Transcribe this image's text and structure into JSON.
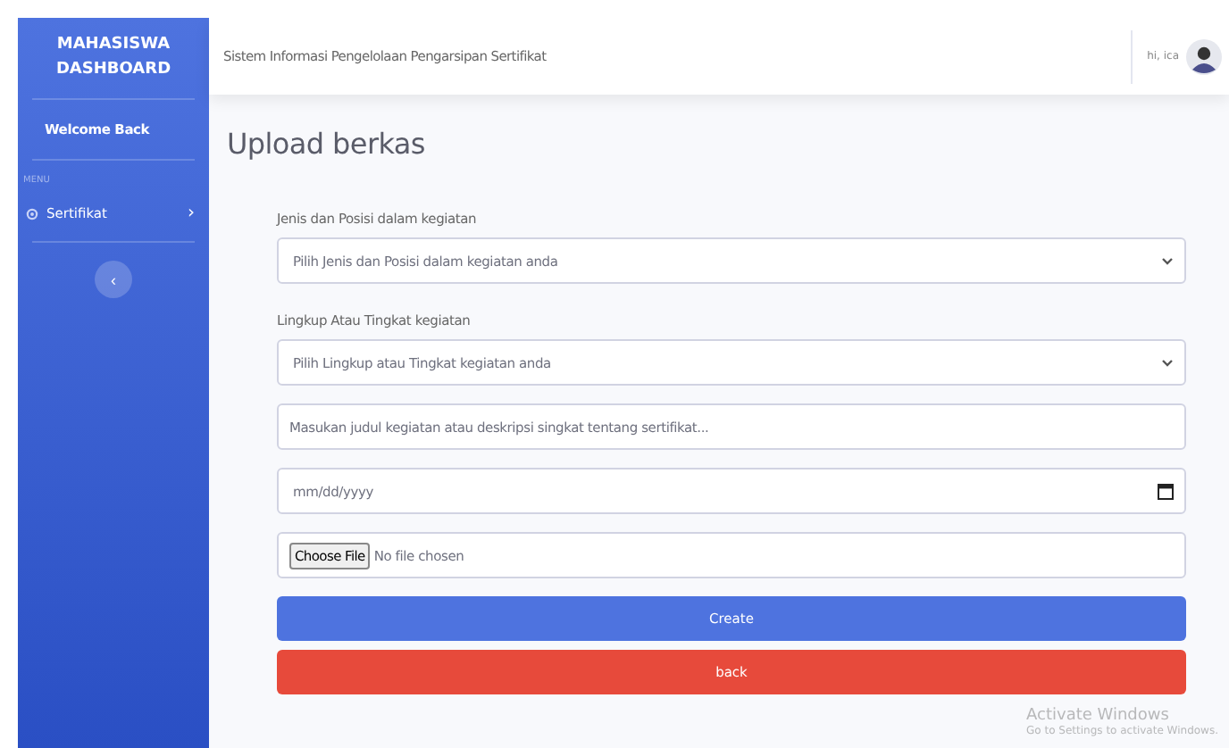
{
  "sidebar": {
    "brand": "MAHASISWA DASHBOARD",
    "welcome": "Welcome Back",
    "menu_heading": "MENU",
    "items": [
      {
        "label": "Sertifikat",
        "chevron": "›"
      }
    ],
    "toggle": "‹"
  },
  "topbar": {
    "title": "Sistem Informasi Pengelolaan Pengarsipan Sertifikat",
    "user": "hi, ica"
  },
  "page_title": "Upload berkas",
  "form": {
    "fields": [
      {
        "kind": "label",
        "text": "Jenis dan Posisi dalam kegiatan"
      },
      {
        "kind": "select",
        "value": "Pilih Jenis dan Posisi dalam kegiatan anda"
      },
      {
        "kind": "label",
        "text": "Lingkup Atau Tingkat kegiatan"
      },
      {
        "kind": "select",
        "value": "Pilih Lingkup atau Tingkat kegiatan anda"
      },
      {
        "kind": "text",
        "placeholder": "Masukan judul kegiatan atau deskripsi singkat tentang sertifikat..."
      },
      {
        "kind": "date",
        "placeholder": "mm/dd/yyyy"
      },
      {
        "kind": "file",
        "button": "Choose File",
        "status": "No file chosen"
      }
    ],
    "buttons": [
      {
        "label": "Create",
        "kind": "primary"
      },
      {
        "label": "back",
        "kind": "danger"
      }
    ]
  },
  "os_notice": {
    "title": "Activate Windows",
    "text": "Go to Settings to activate Windows."
  }
}
